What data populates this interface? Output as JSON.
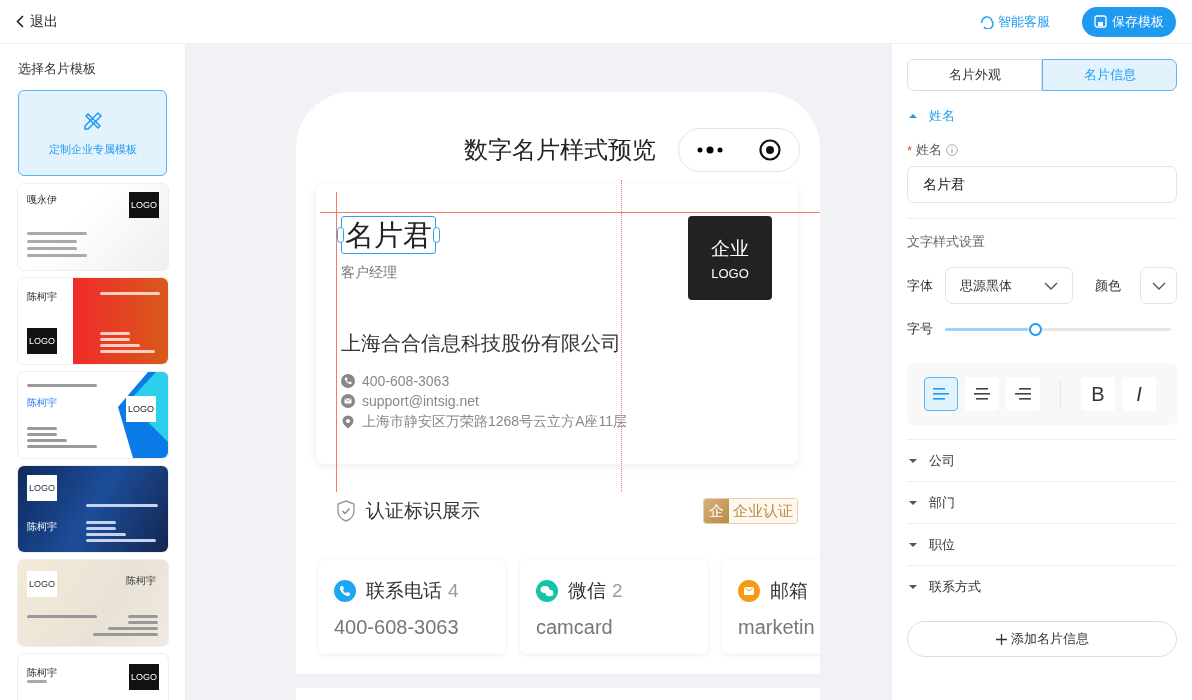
{
  "topbar": {
    "back": "退出",
    "service": "智能客服",
    "save": "保存模板"
  },
  "sidebar": {
    "title": "选择名片模板",
    "custom": "定制企业专属模板",
    "templates": [
      {
        "kind": "light",
        "name": "嘎永伊",
        "logo": "LOGO"
      },
      {
        "kind": "red",
        "name": "陈柯宇",
        "logo": "LOGO"
      },
      {
        "kind": "blue",
        "name": "陈柯宇",
        "logo": "LOGO"
      },
      {
        "kind": "dark",
        "name": "陈柯宇",
        "logo": "LOGO"
      },
      {
        "kind": "beige",
        "name": "陈柯宇",
        "logo": "LOGO"
      },
      {
        "kind": "plain",
        "name": "陈柯宇",
        "logo": "LOGO"
      }
    ]
  },
  "preview": {
    "title": "数字名片样式预览",
    "card": {
      "name": "名片君",
      "title": "客户经理",
      "company": "上海合合信息科技股份有限公司",
      "logo_top": "企业",
      "logo_bottom": "LOGO",
      "contacts": [
        {
          "kind": "phone",
          "text": "400-608-3063"
        },
        {
          "kind": "mail",
          "text": "support@intsig.net"
        },
        {
          "kind": "pin",
          "text": "上海市静安区万荣路1268号云立方A座11层"
        }
      ]
    },
    "cert": {
      "label": "认证标识展示",
      "badge_mark": "企",
      "badge": "企业认证"
    },
    "channels": [
      {
        "kind": "phone",
        "label": "联系电话",
        "count": "4",
        "value": "400-608-3063"
      },
      {
        "kind": "wechat",
        "label": "微信",
        "count": "2",
        "value": "camcard"
      },
      {
        "kind": "mail",
        "label": "邮箱",
        "value": "marketin"
      }
    ]
  },
  "panel": {
    "tabs": [
      {
        "label": "名片外观",
        "selected": false
      },
      {
        "label": "名片信息",
        "selected": true
      }
    ],
    "sections": [
      {
        "label": "姓名",
        "expanded": true,
        "field_label": "姓名",
        "required_mark": "*",
        "value": "名片君",
        "style_title": "文字样式设置",
        "font_label": "字体",
        "font_value": "思源黑体",
        "color_label": "颜色",
        "size_label": "字号",
        "level": 0.4,
        "align": [
          {
            "kind": "left",
            "selected": true
          },
          {
            "kind": "center",
            "selected": false
          },
          {
            "kind": "right",
            "selected": false
          }
        ],
        "styles": [
          {
            "kind": "bold",
            "label": "B"
          },
          {
            "kind": "italic",
            "label": "I"
          }
        ]
      },
      {
        "label": "公司",
        "expanded": false
      },
      {
        "label": "部门",
        "expanded": false
      },
      {
        "label": "职位",
        "expanded": false
      },
      {
        "label": "联系方式",
        "expanded": false
      }
    ],
    "add_button": "添加名片信息"
  }
}
